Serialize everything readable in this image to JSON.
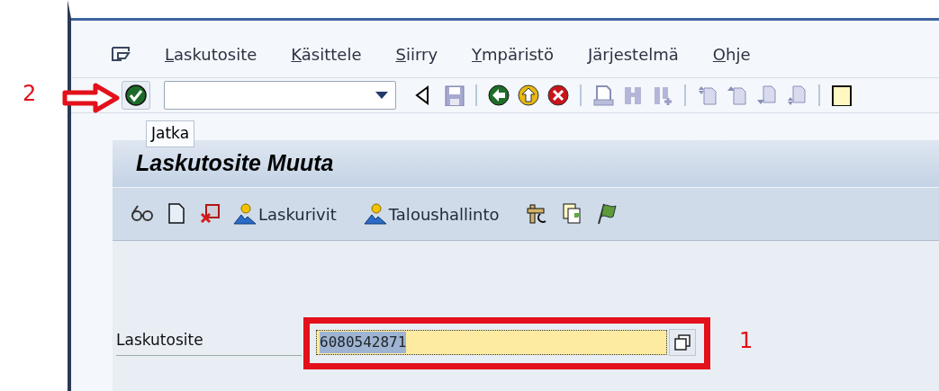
{
  "menu": [
    "Laskutosite",
    "Käsittele",
    "Siirry",
    "Ympäristö",
    "Järjestelmä",
    "Ohje"
  ],
  "tooltip": "Jatka",
  "title": "Laskutosite Muuta",
  "app_toolbar": [
    {
      "kind": "icon"
    },
    {
      "kind": "icon"
    },
    {
      "kind": "icon"
    },
    {
      "kind": "labeled",
      "label": "Laskurivit"
    },
    {
      "kind": "labeled",
      "label": "Taloushallinto"
    },
    {
      "kind": "icon"
    },
    {
      "kind": "icon"
    },
    {
      "kind": "icon"
    }
  ],
  "field": {
    "label": "Laskutosite",
    "value": "6080542871",
    "selected": true
  },
  "annotations": [
    "1",
    "2"
  ]
}
